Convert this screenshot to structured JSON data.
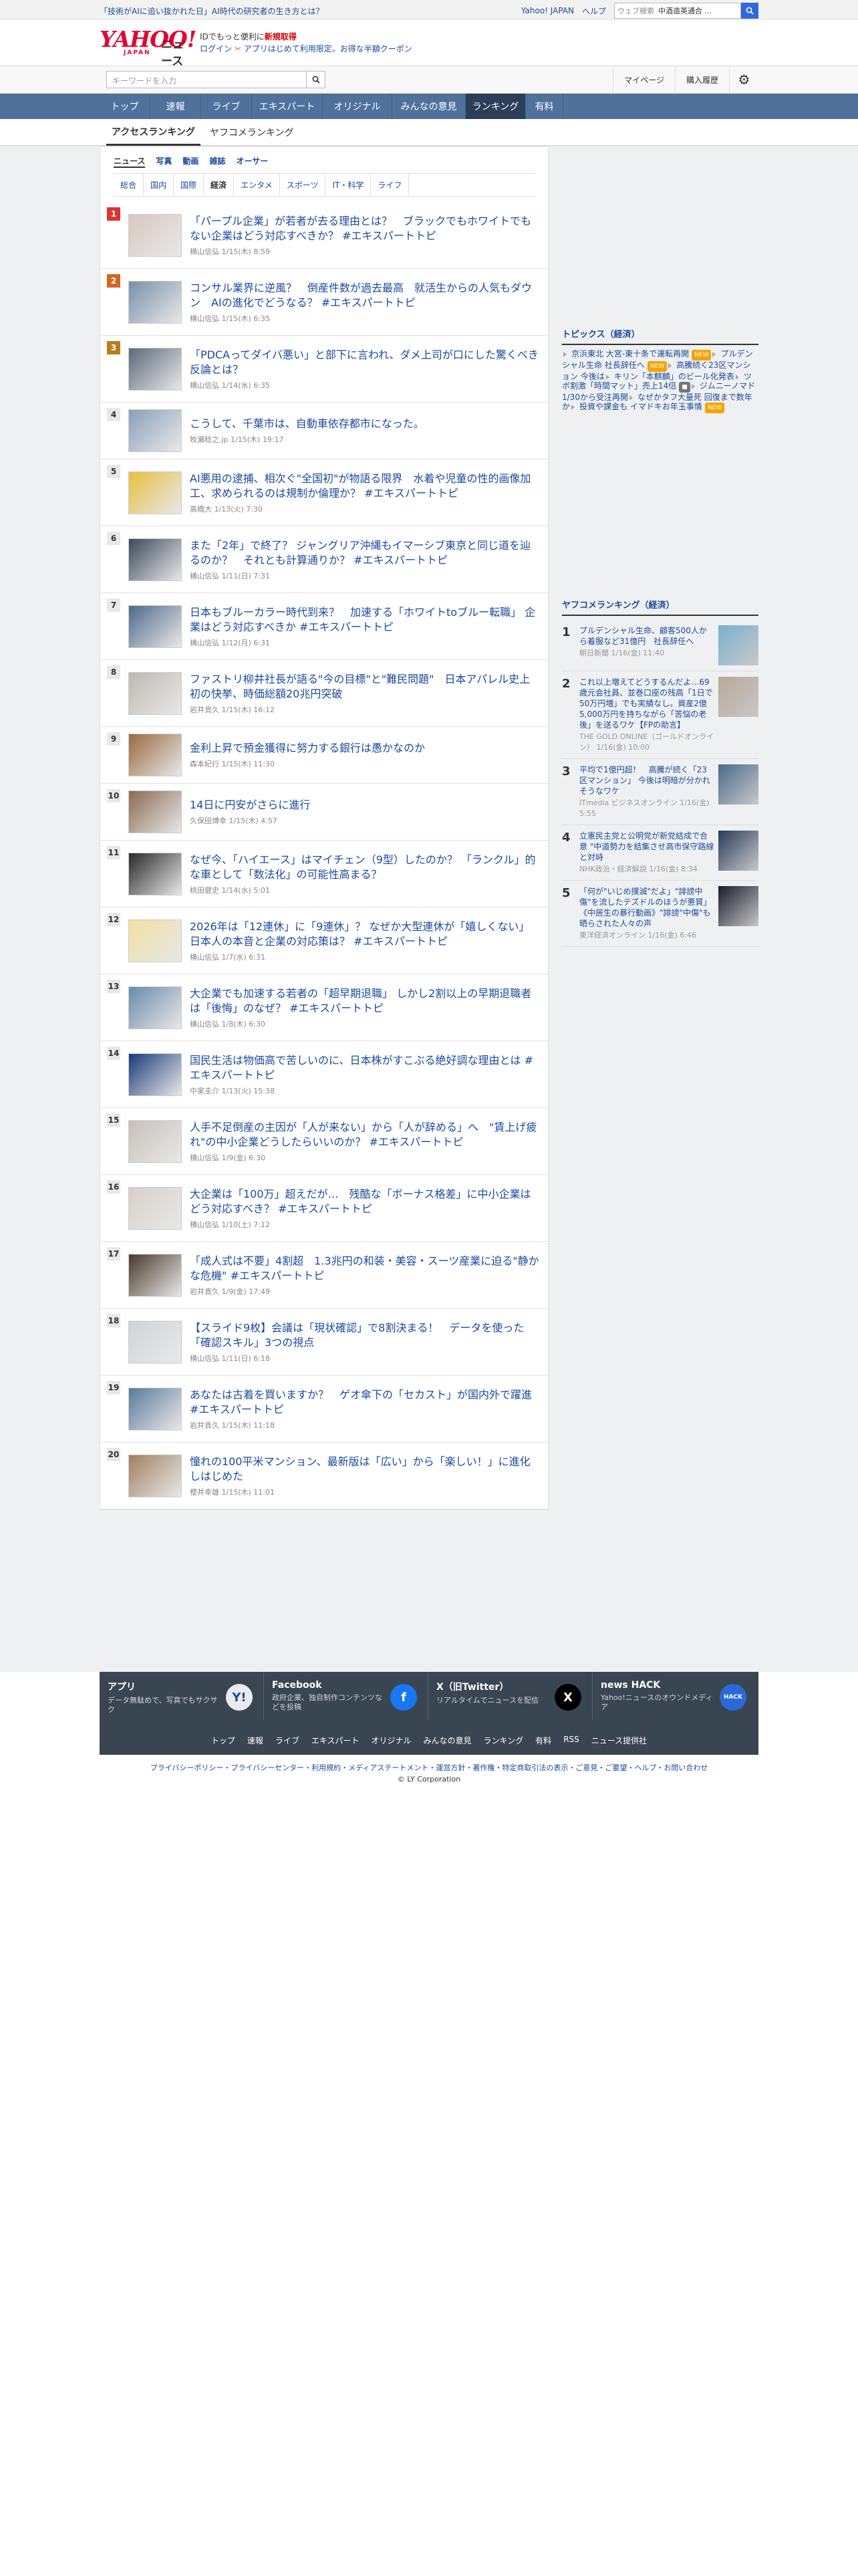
{
  "topstrip": {
    "promo": "「技術がAIに追い抜かれた日」AI時代の研究者の生き方とは？",
    "links": [
      "Yahoo! JAPAN",
      "ヘルプ"
    ],
    "search_placeholder": "ウェブ検索",
    "search_value": "中酒造英通合 ..."
  },
  "header": {
    "logo": "YAHOO!",
    "logo_sub": "JAPAN",
    "service": "ニュース",
    "msg1_pre": "ID",
    "msg1": "でもっと便利に",
    "msg1_strong": "新規取得",
    "login": "ログイン",
    "msg2_pre": "アプリ",
    "msg2": "はじめて利用限定。お得な半額クーポン"
  },
  "subbar": {
    "keyword_placeholder": "キーワードを入力",
    "mypage": "マイページ",
    "history": "購入履歴"
  },
  "gnav": [
    "トップ",
    "速報",
    "ライブ",
    "エキスパート",
    "オリジナル",
    "みんなの意見",
    "ランキング",
    "有料"
  ],
  "gnav_active": 6,
  "rnav": {
    "tabs": [
      "アクセスランキング",
      "ヤフコメランキング"
    ]
  },
  "cat1": [
    "ニュース",
    "写真",
    "動画",
    "雑誌",
    "オーサー"
  ],
  "cat2": [
    "総合",
    "国内",
    "国際",
    "経済",
    "エンタメ",
    "スポーツ",
    "IT・科学",
    "ライフ"
  ],
  "ranking": [
    {
      "rank": "1",
      "title": "「パープル企業」が若者が去る理由とは？　ブラックでもホワイトでもない企業はどう対応すべきか？ #エキスパートトピ",
      "meta": "横山信弘  1/15(木) 8:59",
      "color": "#d8c7c0"
    },
    {
      "rank": "2",
      "title": "コンサル業界に逆風？　倒産件数が過去最高　就活生からの人気もダウン　AIの進化でどうなる？ #エキスパートトピ",
      "meta": "横山信弘  1/15(木) 6:35",
      "color": "#7890a8"
    },
    {
      "rank": "3",
      "title": "「PDCAってダイバ悪い」と部下に言われ、ダメ上司が口にした驚くべき反論とは？",
      "meta": "横山信弘  1/14(水) 6:35",
      "color": "#5a6a7a"
    },
    {
      "rank": "4",
      "title": "こうして、千葉市は、自動車依存都市になった。",
      "meta": "牧瀬稔之.jp  1/15(木) 19:17",
      "color": "#8aa0b8"
    },
    {
      "rank": "5",
      "title": "AI悪用の逮捕、相次ぐ\"全国初\"が物語る限界　水着や児童の性的画像加工、求められるのは規制か倫理か？ #エキスパートトピ",
      "meta": "高橋大  1/13(火) 7:30",
      "color": "#e8c040"
    },
    {
      "rank": "6",
      "title": "また「2年」で終了？ ジャングリア沖縄もイマーシブ東京と同じ道を辿るのか？　それとも計算通りか？ #エキスパートトピ",
      "meta": "横山信弘  1/11(日) 7:31",
      "color": "#3a4a5a"
    },
    {
      "rank": "7",
      "title": "日本もブルーカラー時代到来？　加速する「ホワイトtoブルー転職」 企業はどう対応すべきか #エキスパートトピ",
      "meta": "横山信弘  1/12(月) 6:31",
      "color": "#4e6a8a"
    },
    {
      "rank": "8",
      "title": "ファストリ柳井社長が語る\"今の目標\"と\"難民問題\"　日本アパレル史上初の快挙、時価総額20兆円突破",
      "meta": "岩井貴久  1/15(木) 16:12",
      "color": "#c0b8b0"
    },
    {
      "rank": "9",
      "title": "金利上昇で預金獲得に努力する銀行は愚かなのか",
      "meta": "森本紀行  1/15(木) 11:30",
      "color": "#9a6a40"
    },
    {
      "rank": "10",
      "title": "14日に円安がさらに進行",
      "meta": "久保田博幸  1/15(木) 4:57",
      "color": "#8a6a50"
    },
    {
      "rank": "11",
      "title": "なぜ今、「ハイエース」はマイチェン（9型）したのか？ 「ランクル」的な車として「数法化」の可能性高まる？",
      "meta": "桃田健史  1/14(水) 5:01",
      "color": "#2a2a2a"
    },
    {
      "rank": "12",
      "title": "2026年は「12連休」に「9連休」？ なぜか大型連休が「嬉しくない」日本人の本音と企業の対応策は？ #エキスパートトピ",
      "meta": "横山信弘  1/7(水) 6:31",
      "color": "#f0e0a0"
    },
    {
      "rank": "13",
      "title": "大企業でも加速する若者の「超早期退職」 しかし2割以上の早期退職者は「後悔」のなぜ？ #エキスパートトピ",
      "meta": "横山信弘  1/8(木) 6:30",
      "color": "#6a8aaa"
    },
    {
      "rank": "14",
      "title": "国民生活は物価高で苦しいのに、日本株がすこぶる絶好調な理由とは #エキスパートトピ",
      "meta": "中家圭介  1/13(火) 15:38",
      "color": "#1a3a7a"
    },
    {
      "rank": "15",
      "title": "人手不足倒産の主因が「人が来ない」から「人が辞める」へ　\"賃上げ疲れ\"の中小企業どうしたらいいのか？ #エキスパートトピ",
      "meta": "横山信弘  1/9(金) 6:30",
      "color": "#c8c0b8"
    },
    {
      "rank": "16",
      "title": "大企業は「100万」超えだが…　残酷な「ボーナス格差」に中小企業はどう対応すべき？ #エキスパートトピ",
      "meta": "横山信弘  1/10(土) 7:12",
      "color": "#d8d0c8"
    },
    {
      "rank": "17",
      "title": "「成人式は不要」4割超　1.3兆円の和装・美容・スーツ産業に迫る\"静かな危機\" #エキスパートトピ",
      "meta": "岩井貴久  1/9(金) 17:49",
      "color": "#4a3a2a"
    },
    {
      "rank": "18",
      "title": "【スライド9枚】会議は「現状確認」で8割決まる！　データを使った「確認スキル」3つの視点",
      "meta": "横山信弘  1/11(日) 6:18",
      "color": "#d0d4d8"
    },
    {
      "rank": "19",
      "title": "あなたは古着を買いますか？　ゲオ傘下の「セカスト」が国内外で躍進 #エキスパートトピ",
      "meta": "岩井貴久  1/15(木) 11:18",
      "color": "#5a7a9a"
    },
    {
      "rank": "20",
      "title": "憧れの100平米マンション、最新版は「広い」から「楽しい！」に進化しはじめた",
      "meta": "櫻井幸雄  1/15(木) 11:01",
      "color": "#a08060"
    }
  ],
  "topics": {
    "title": "トピックス（経済）",
    "items": [
      {
        "t": "京浜東北 大宮-東十条で運転再開",
        "tag": "NEW",
        "k": "new"
      },
      {
        "t": "プルデンシャル生命 社長辞任へ",
        "tag": "NEW",
        "k": "new"
      },
      {
        "t": "高騰続く23区マンション 今後は",
        "tag": "",
        "k": ""
      },
      {
        "t": "キリン「本麒麟」のビール化発表",
        "tag": "",
        "k": ""
      },
      {
        "t": "ツボ割激「時間マット」売上14倍",
        "tag": "■",
        "k": "img"
      },
      {
        "t": "ジムニーノマド 1/30から受注再開",
        "tag": "",
        "k": ""
      },
      {
        "t": "なぜかタフ大量死 回復まで数年か",
        "tag": "",
        "k": ""
      },
      {
        "t": "投資や課金も イマドキお年玉事情",
        "tag": "NEW",
        "k": "new"
      }
    ]
  },
  "yrank": {
    "title": "ヤフコメランキング（経済）",
    "items": [
      {
        "n": "1",
        "t": "プルデンシャル生命、顧客500人から着服など31億円　社長辞任へ",
        "m": "朝日新聞  1/16(金) 11:40",
        "color": "#7ab0d0"
      },
      {
        "n": "2",
        "t": "これ以上増えてどうするんだよ…69歳元会社員、並巻口座の残高「1日で50万円増」でも実績なし。資産2億5,000万円を持ちながら「苦悩の老後」を送るワケ【FPの助言】",
        "m": "THE GOLD ONLINE（ゴールドオンライン）  1/16(金) 10:00",
        "color": "#b8a898"
      },
      {
        "n": "3",
        "t": "平均で1億円超！　高騰が続く「23区マンション」 今後は明暗が分かれそうなワケ",
        "m": "ITmedia ビジネスオンライン  1/16(金) 5:55",
        "color": "#4a6a8a"
      },
      {
        "n": "4",
        "t": "立憲民主党と公明党が新党結成で合意 \"中道勢力を結集させ高市保守路線と対峙",
        "m": "NHK政治・経済解説  1/16(金) 8:34",
        "color": "#2a3a5a"
      },
      {
        "n": "5",
        "t": "「何が\"いじめ撲滅\"だよ」\"誹謗中傷\"を流したテズドルのほうが悪質」《中居生の暴行動画》\"誹謗\"中傷\"も晒らされた人々の声",
        "m": "東洋経済オンライン  1/16(金) 6:46",
        "color": "#1a1a2a"
      }
    ]
  },
  "footer": {
    "apps": [
      {
        "name": "アプリ",
        "desc": "データ無駄めで、写真でもサクサク",
        "icon": "Y!",
        "color": "#e8eaee",
        "fg": "#1a4a9a"
      },
      {
        "name": "Facebook",
        "desc": "政府企業、独自制作コンテンツなどを投稿",
        "icon": "f",
        "color": "#1877f2",
        "fg": "#fff"
      },
      {
        "name": "X（旧Twitter）",
        "desc": "リアルタイムでニュースを配信",
        "icon": "X",
        "color": "#000",
        "fg": "#fff"
      },
      {
        "name": "news HACK",
        "desc": "Yahoo!ニュースのオウンドメディア",
        "icon": "HACK",
        "color": "#2a6ad8",
        "fg": "#fff"
      }
    ],
    "links": [
      "トップ",
      "速報",
      "ライブ",
      "エキスパート",
      "オリジナル",
      "みんなの意見",
      "ランキング",
      "有料",
      "RSS",
      "ニュース提供社"
    ],
    "legal": "プライバシーポリシー・プライバシーセンター・利用規約・メディアステートメント・運営方針・著作権・特定商取引法の表示・ご意見・ご要望・ヘルプ・お問い合わせ",
    "copyright": "© LY Corporation"
  }
}
